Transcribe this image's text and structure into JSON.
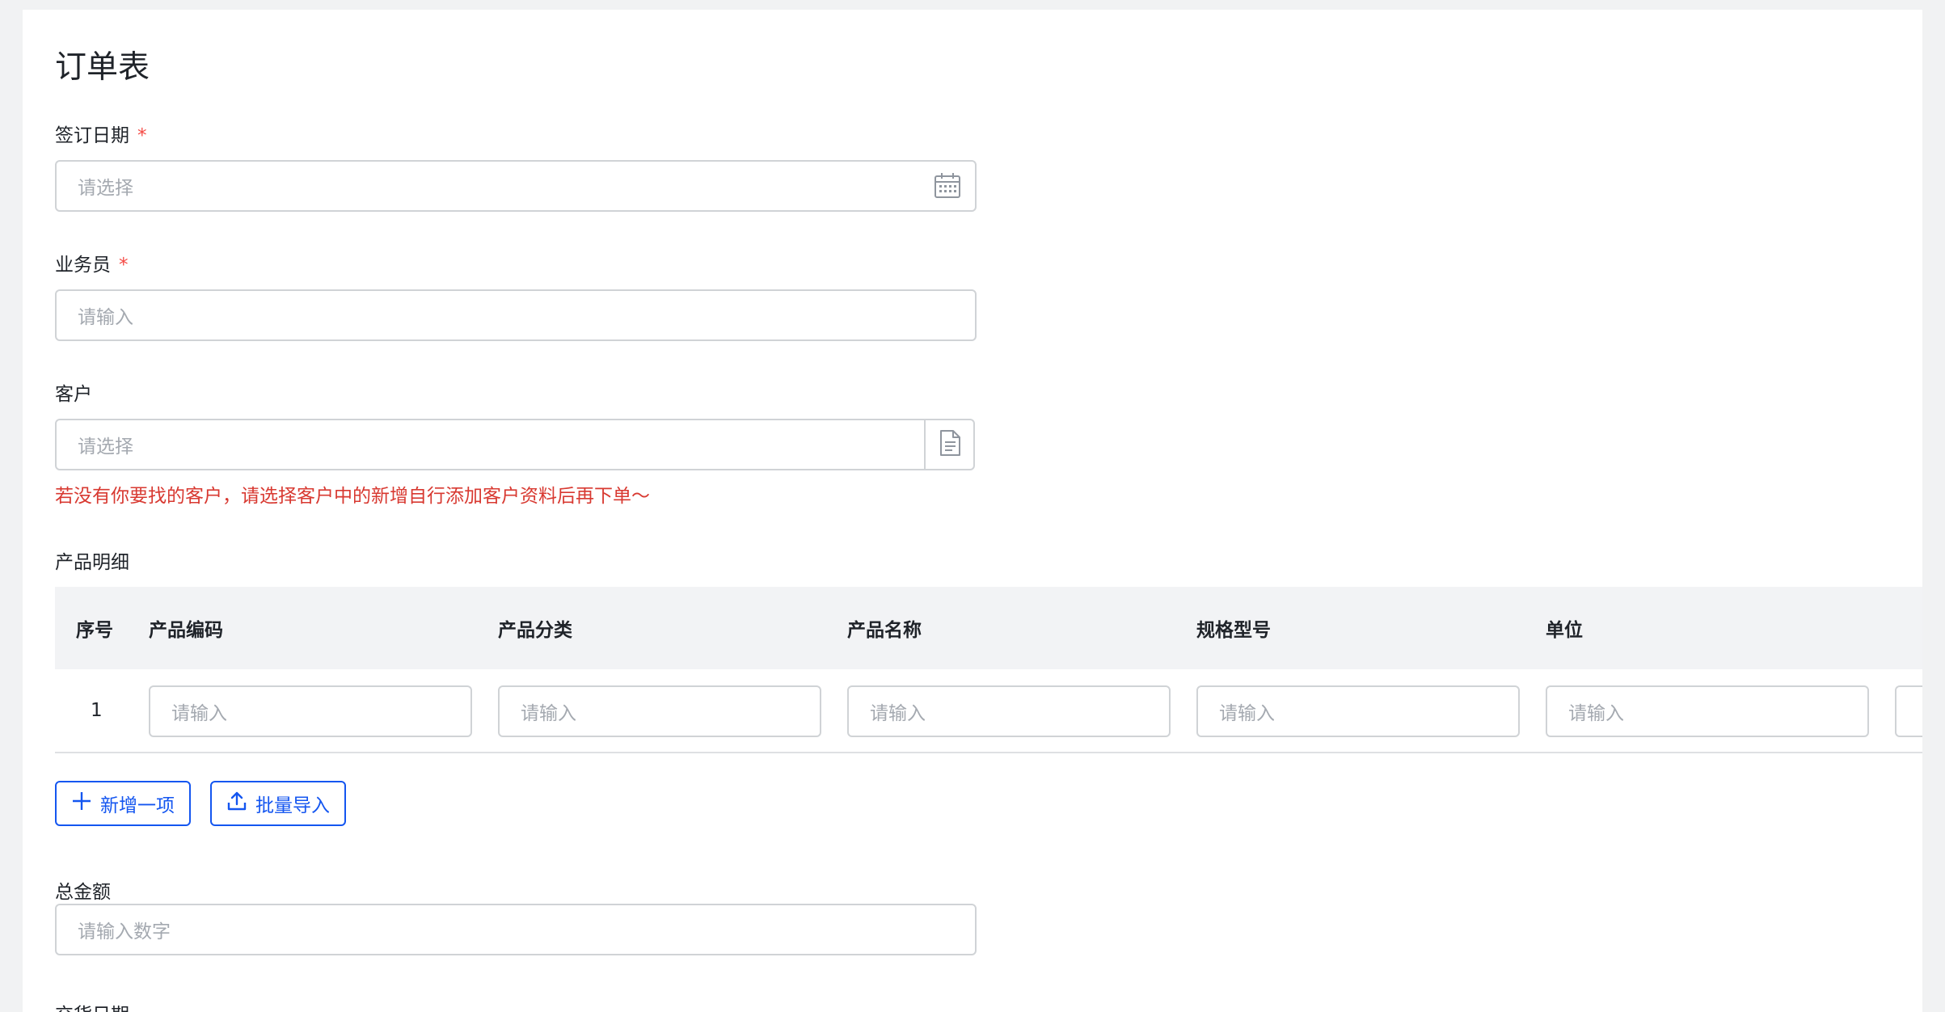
{
  "form": {
    "title": "订单表",
    "required_mark": "*",
    "sign_date": {
      "label": "签订日期",
      "placeholder": "请选择",
      "icon": "calendar-icon"
    },
    "salesperson": {
      "label": "业务员",
      "placeholder": "请输入"
    },
    "customer": {
      "label": "客户",
      "placeholder": "请选择",
      "icon": "document-icon",
      "hint": "若没有你要找的客户，请选择客户中的新增自行添加客户资料后再下单～"
    },
    "products": {
      "label": "产品明细",
      "columns": [
        "序号",
        "产品编码",
        "产品分类",
        "产品名称",
        "规格型号",
        "单位"
      ],
      "rows": [
        {
          "index": "1",
          "placeholders": [
            "请输入",
            "请输入",
            "请输入",
            "请输入",
            "请输入"
          ]
        }
      ],
      "add_button": "新增一项",
      "import_button": "批量导入"
    },
    "total_amount": {
      "label": "总金额",
      "placeholder": "请输入数字"
    },
    "next_label_partial": "交货日期"
  },
  "colors": {
    "accent": "#1456f0",
    "required": "#f54a45",
    "hint": "#d83931",
    "placeholder": "#a4a9b0"
  }
}
